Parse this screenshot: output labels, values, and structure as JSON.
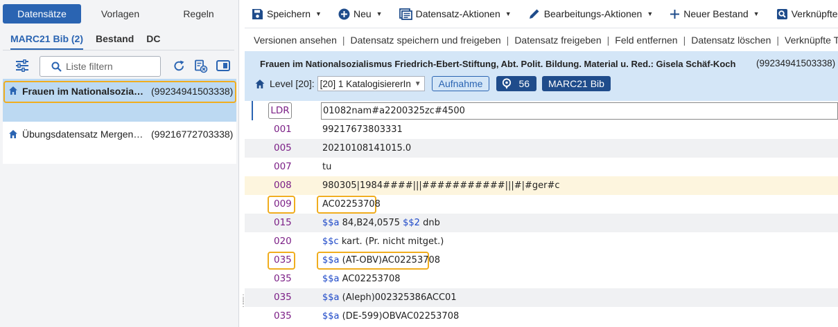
{
  "left": {
    "top_tabs": [
      "Datensätze",
      "Vorlagen",
      "Regeln"
    ],
    "sub_tabs": [
      "MARC21 Bib (2)",
      "Bestand",
      "DC"
    ],
    "filter_placeholder": "Liste filtern",
    "records": [
      {
        "title": "Frauen im Nationalsozialis…",
        "mms": "(99234941503338)"
      },
      {
        "title": "Übungsdatensatz Mergen: …",
        "mms": "(99216772703338)"
      }
    ]
  },
  "toolbar": {
    "save": "Speichern",
    "new": "Neu",
    "record_actions": "Datensatz-Aktionen",
    "edit_actions": "Bearbeitungs-Aktionen",
    "new_holding": "Neuer Bestand",
    "linked": "Verknüpfte D"
  },
  "actions": [
    "Versionen ansehen",
    "Datensatz speichern und freigeben",
    "Datensatz freigeben",
    "Feld entfernen",
    "Datensatz löschen",
    "Verknüpfte Tit"
  ],
  "record": {
    "title": "Frauen im Nationalsozialismus Friedrich-Ebert-Stiftung, Abt. Polit. Bildung. Material u. Red.: Gisela Schäf-Koch",
    "mms": "(99234941503338)",
    "level_label": "Level [20]:",
    "level_value": "[20] 1 KatalogisiererIn",
    "aufnahme": "Aufnahme",
    "count": "56",
    "format": "MARC21 Bib"
  },
  "marc": {
    "ldr_tag": "LDR",
    "ldr_value": "01082nam#a2200325zc#4500",
    "fields": [
      {
        "tag": "001",
        "parts": [
          {
            "t": "99217673803331"
          }
        ]
      },
      {
        "tag": "005",
        "parts": [
          {
            "t": "20210108141015.0"
          }
        ]
      },
      {
        "tag": "007",
        "parts": [
          {
            "t": "tu"
          }
        ]
      },
      {
        "tag": "008",
        "parts": [
          {
            "t": "980305|1984####|||###########|||#|#ger#c"
          }
        ]
      },
      {
        "tag": "009",
        "parts": [
          {
            "t": "AC02253708"
          }
        ]
      },
      {
        "tag": "015",
        "parts": [
          {
            "s": "$$a"
          },
          {
            "t": " 84,B24,0575 "
          },
          {
            "s": "$$2"
          },
          {
            "t": " dnb"
          }
        ]
      },
      {
        "tag": "020",
        "parts": [
          {
            "s": "$$c"
          },
          {
            "t": " kart. (Pr. nicht mitget.)"
          }
        ]
      },
      {
        "tag": "035",
        "parts": [
          {
            "s": "$$a"
          },
          {
            "t": " (AT-OBV)AC02253708"
          }
        ]
      },
      {
        "tag": "035",
        "parts": [
          {
            "s": "$$a"
          },
          {
            "t": " AC02253708"
          }
        ]
      },
      {
        "tag": "035",
        "parts": [
          {
            "s": "$$a"
          },
          {
            "t": " (Aleph)002325386ACC01"
          }
        ]
      },
      {
        "tag": "035",
        "parts": [
          {
            "s": "$$a"
          },
          {
            "t": " (DE-599)OBVAC02253708"
          }
        ]
      }
    ]
  },
  "colors": {
    "accent": "#2a64b2",
    "highlight": "#f0ad1e",
    "tag": "#7b1f86",
    "subfield": "#1d48c8",
    "header_band": "#d4e6f7"
  }
}
